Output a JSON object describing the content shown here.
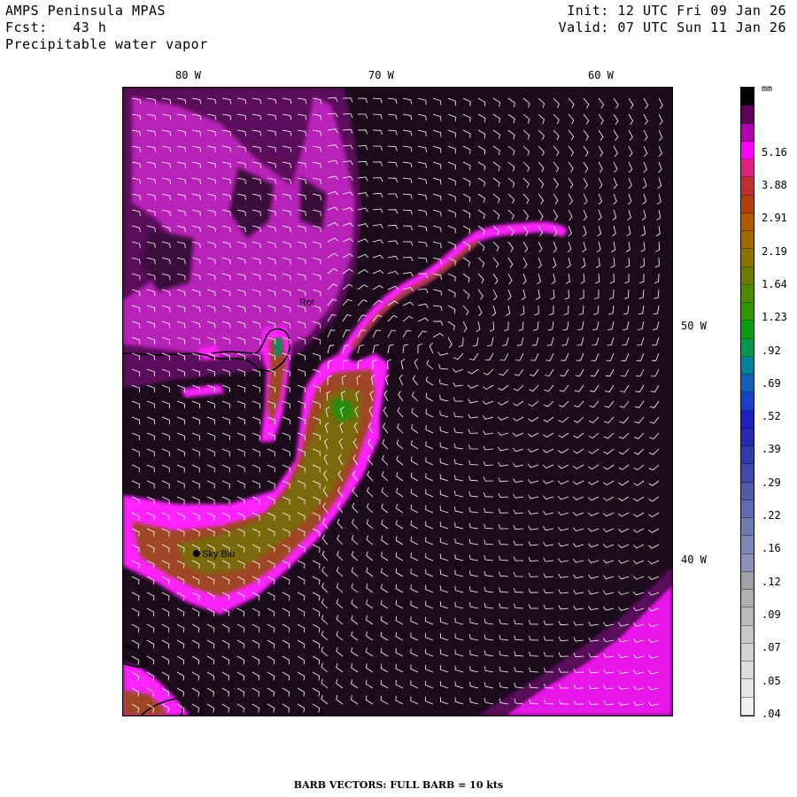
{
  "header": {
    "model": "AMPS Peninsula MPAS",
    "forecast": "Fcst:   43 h",
    "field": "Precipitable water vapor",
    "init": "Init: 12 UTC Fri 09 Jan 26",
    "valid": "Valid: 07 UTC Sun 11 Jan 26"
  },
  "lon_labels": [
    "80 W",
    "70 W",
    "60 W"
  ],
  "lat_labels": [
    "50 W",
    "40 W"
  ],
  "colorbar": {
    "unit": "mm",
    "colors": [
      "#000000",
      "#5c0058",
      "#b000b0",
      "#ff00ff",
      "#e02080",
      "#c03030",
      "#b04010",
      "#b05a00",
      "#a06800",
      "#8a7000",
      "#6b7a00",
      "#4e8a00",
      "#2e9600",
      "#0a9c0a",
      "#009850",
      "#00809a",
      "#1060b8",
      "#1840c8",
      "#2020c0",
      "#2828b0",
      "#303aa8",
      "#4048a8",
      "#505aa8",
      "#606ab0",
      "#7078b0",
      "#8088b8",
      "#9090b8",
      "#a0a0a8",
      "#b0b0b0",
      "#bcbcbc",
      "#c8c8c8",
      "#d2d2d2",
      "#dcdcdc",
      "#e6e6e6",
      "#f0f0f0"
    ],
    "labels": [
      {
        "text": "5.16",
        "index": 4
      },
      {
        "text": "3.88",
        "index": 6
      },
      {
        "text": "2.91",
        "index": 8
      },
      {
        "text": "2.19",
        "index": 10
      },
      {
        "text": "1.64",
        "index": 12
      },
      {
        "text": "1.23",
        "index": 14
      },
      {
        "text": ".92",
        "index": 16
      },
      {
        "text": ".69",
        "index": 18
      },
      {
        "text": ".52",
        "index": 20
      },
      {
        "text": ".39",
        "index": 22
      },
      {
        "text": ".29",
        "index": 24
      },
      {
        "text": ".22",
        "index": 26
      },
      {
        "text": ".16",
        "index": 28
      },
      {
        "text": ".12",
        "index": 30
      },
      {
        "text": ".09",
        "index": 32
      },
      {
        "text": ".07",
        "index": 34
      },
      {
        "text": ".05",
        "index": 36
      },
      {
        "text": ".04",
        "index": 38
      }
    ]
  },
  "stations": [
    {
      "name": "Sky Blu"
    },
    {
      "name": "Rot"
    }
  ],
  "footer": "BARB VECTORS:  FULL BARB = 10 kts"
}
